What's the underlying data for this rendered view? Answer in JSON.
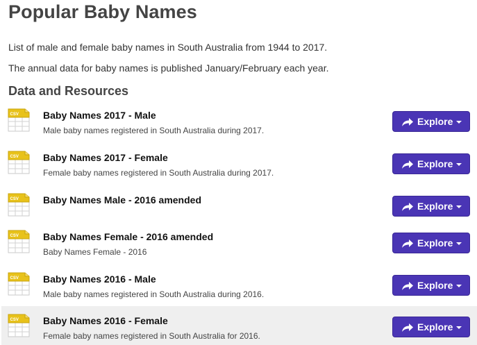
{
  "page": {
    "title": "Popular Baby Names",
    "description_1": "List of male and female baby names in South Australia from 1944 to 2017.",
    "description_2": "The annual data for baby names is published January/February each year."
  },
  "resources_section": {
    "heading": "Data and Resources",
    "file_format": "CSV",
    "icon": "csv-file-icon",
    "button_icon": "share-icon",
    "button_caret": "chevron-down-icon",
    "accent_color": "#4a35b5",
    "items": [
      {
        "title": "Baby Names 2017 - Male",
        "description": "Male baby names registered in South Australia during 2017.",
        "button_label": "Explore"
      },
      {
        "title": "Baby Names 2017 - Female",
        "description": "Female baby names registered in South Australia during 2017.",
        "button_label": "Explore"
      },
      {
        "title": "Baby Names Male - 2016 amended",
        "description": "",
        "button_label": "Explore"
      },
      {
        "title": "Baby Names Female - 2016 amended",
        "description": "Baby Names Female - 2016",
        "button_label": "Explore"
      },
      {
        "title": "Baby Names 2016 - Male",
        "description": "Male baby names registered in South Australia during 2016.",
        "button_label": "Explore"
      },
      {
        "title": "Baby Names 2016 - Female",
        "description": "Female baby names registered in South Australia for 2016.",
        "button_label": "Explore"
      }
    ]
  }
}
